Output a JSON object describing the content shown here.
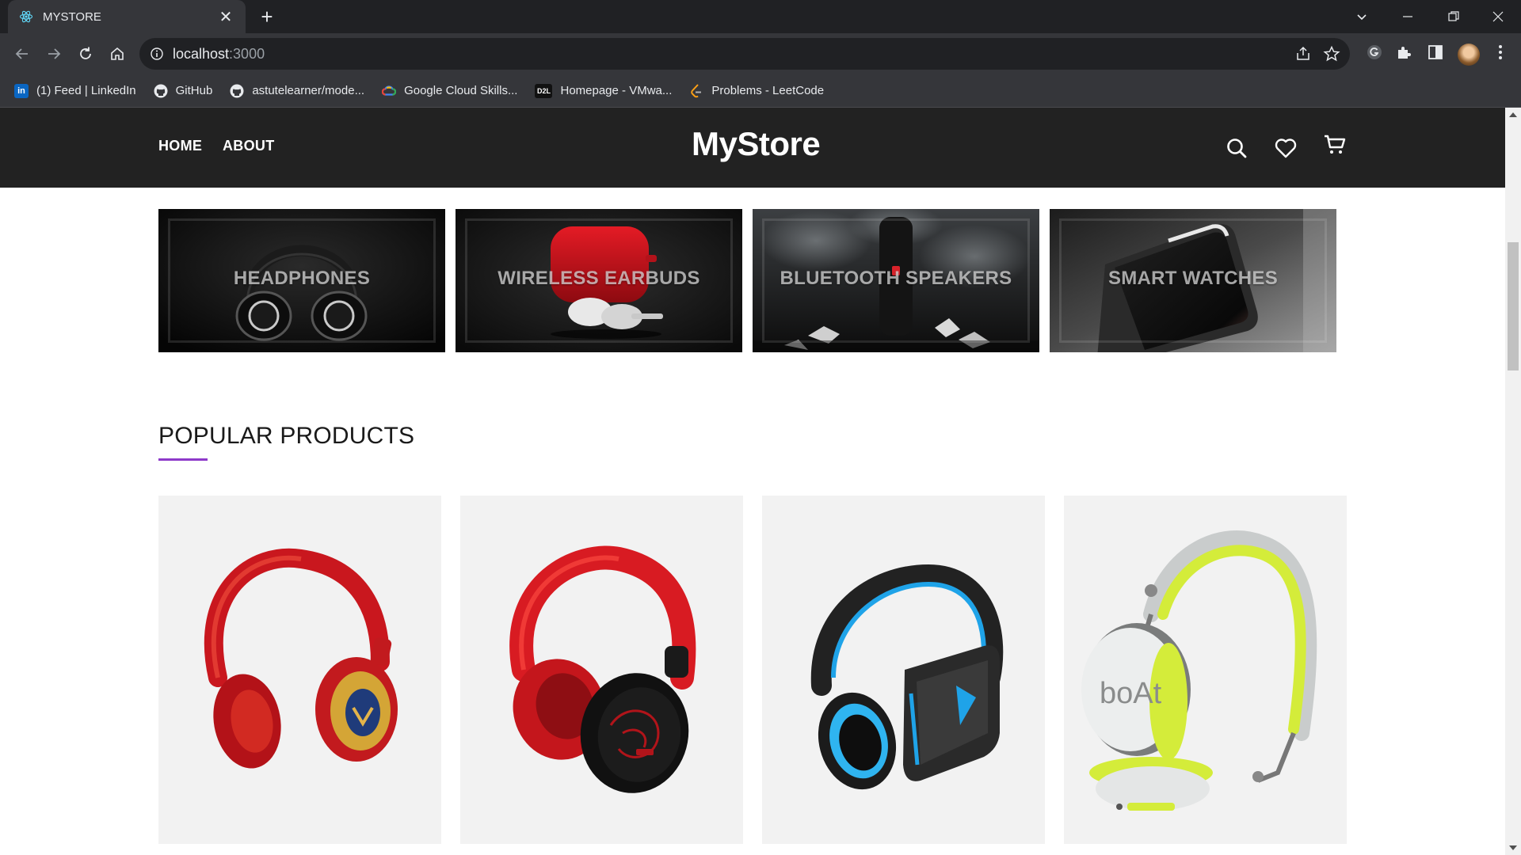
{
  "browser": {
    "tab_title": "MYSTORE",
    "url_host": "localhost",
    "url_port": ":3000",
    "bookmarks": [
      {
        "label": "(1) Feed | LinkedIn",
        "icon": "linkedin-icon"
      },
      {
        "label": "GitHub",
        "icon": "github-icon"
      },
      {
        "label": "astutelearner/mode...",
        "icon": "github-icon"
      },
      {
        "label": "Google Cloud Skills...",
        "icon": "google-cloud-icon"
      },
      {
        "label": "Homepage - VMwa...",
        "icon": "d2l-icon"
      },
      {
        "label": "Problems - LeetCode",
        "icon": "leetcode-icon"
      }
    ],
    "d2l_text": "D2L",
    "linkedin_text": "in"
  },
  "header": {
    "nav": [
      "HOME",
      "ABOUT"
    ],
    "logo": "MyStore"
  },
  "categories": [
    {
      "label": "HEADPHONES"
    },
    {
      "label": "WIRELESS EARBUDS"
    },
    {
      "label": "BLUETOOTH SPEAKERS"
    },
    {
      "label": "SMART WATCHES"
    }
  ],
  "popular": {
    "title": "POPULAR PRODUCTS",
    "accent": "#8e3ac9",
    "products": [
      {
        "image": "red-gold-headphones"
      },
      {
        "image": "red-black-headphones"
      },
      {
        "image": "blue-black-gaming-headphones"
      },
      {
        "image": "white-lime-boat-headphones",
        "brand": "boAt"
      }
    ]
  }
}
